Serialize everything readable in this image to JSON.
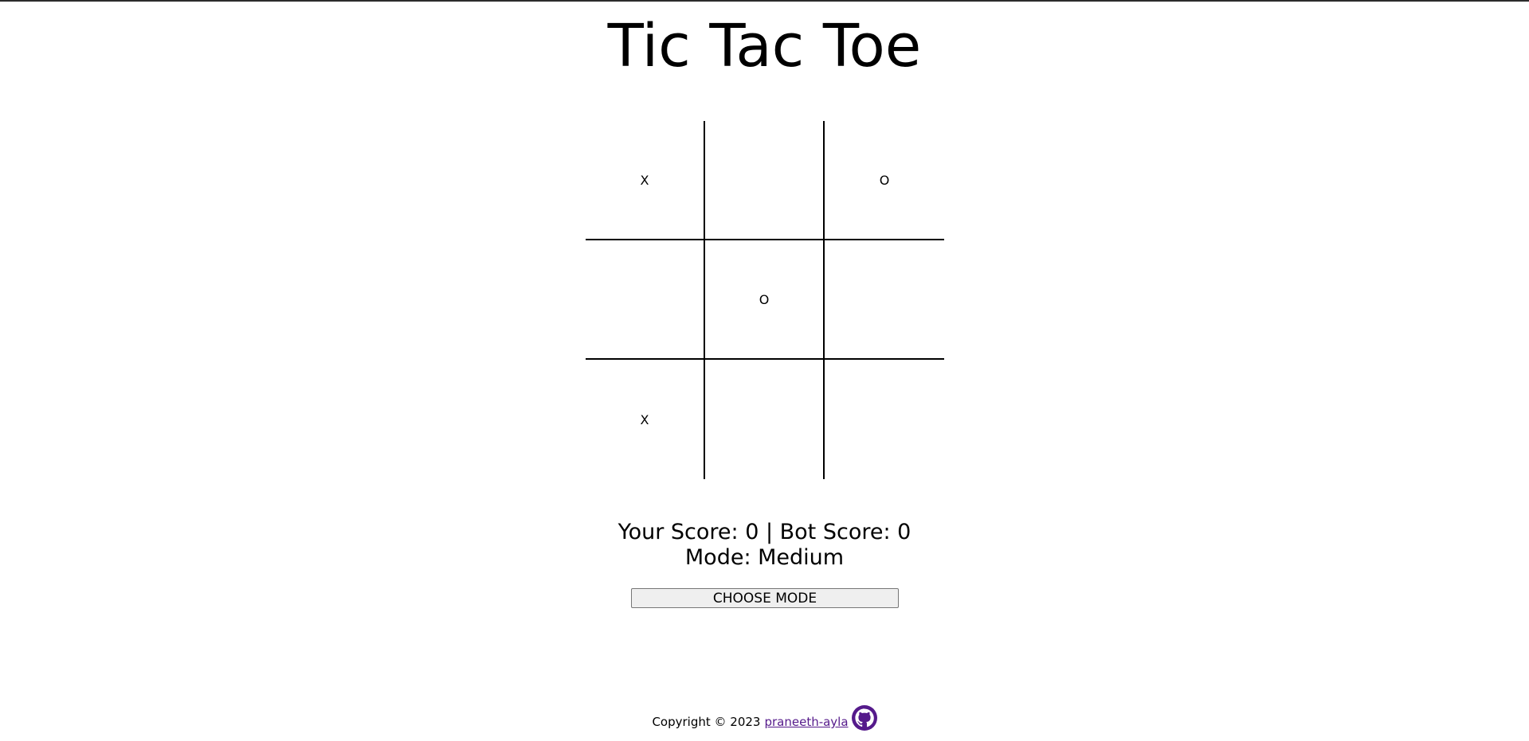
{
  "header": {
    "title": "Tic Tac Toe"
  },
  "board": {
    "cells": [
      "X",
      "",
      "O",
      "",
      "O",
      "",
      "X",
      "",
      ""
    ]
  },
  "scoreboard": {
    "score_text": "Your Score: 0 | Bot Score: 0",
    "mode_text": "Mode: Medium"
  },
  "controls": {
    "choose_mode_label": "CHOOSE MODE"
  },
  "footer": {
    "copyright": "Copyright © 2023",
    "author_link": "praneeth-ayla",
    "icon": "github-icon"
  },
  "colors": {
    "link": "#551a8b",
    "button_bg": "#efefef",
    "grid_lines": "#000000"
  }
}
